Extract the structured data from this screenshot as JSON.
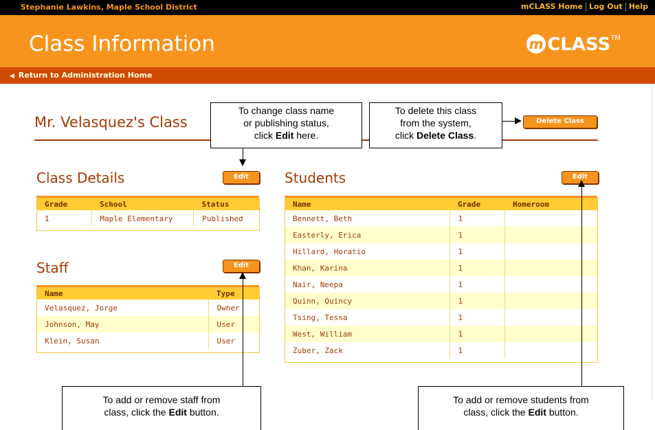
{
  "topbar": {
    "user": "Stephanie Lawkins, Maple School District",
    "links": [
      "mCLASS Home",
      "Log Out",
      "Help"
    ]
  },
  "header": {
    "title": "Class Information",
    "logo_text": "CLASS",
    "logo_m": "m",
    "logo_tm": "TM"
  },
  "subbar": {
    "return_link": "Return to Administration Home"
  },
  "page": {
    "class_title": "Mr. Velasquez's Class",
    "delete_button": "Delete Class"
  },
  "class_details": {
    "title": "Class Details",
    "edit": "Edit",
    "headers": [
      "Grade",
      "School",
      "Status"
    ],
    "row": [
      "1",
      "Maple Elementary",
      "Published"
    ]
  },
  "staff": {
    "title": "Staff",
    "edit": "Edit",
    "headers": [
      "Name",
      "Type"
    ],
    "rows": [
      [
        "Velasquez, Jorge",
        "Owner"
      ],
      [
        "Johnson, May",
        "User"
      ],
      [
        "Klein, Susan",
        "User"
      ]
    ]
  },
  "students": {
    "title": "Students",
    "edit": "Edit",
    "headers": [
      "Name",
      "Grade",
      "Homeroom"
    ],
    "rows": [
      [
        "Bennett, Beth",
        "1",
        ""
      ],
      [
        "Easterly, Erica",
        "1",
        ""
      ],
      [
        "Hillard, Horatio",
        "1",
        ""
      ],
      [
        "Khan, Karina",
        "1",
        ""
      ],
      [
        "Nair, Neepa",
        "1",
        ""
      ],
      [
        "Quinn, Quincy",
        "1",
        ""
      ],
      [
        "Tsing, Tessa",
        "1",
        ""
      ],
      [
        "West, William",
        "1",
        ""
      ],
      [
        "Zuber, Zack",
        "1",
        ""
      ]
    ]
  },
  "callouts": {
    "edit_class": {
      "l1": "To change class name",
      "l2": "or publishing status,",
      "l3a": "click ",
      "l3b": "Edit",
      "l3c": " here."
    },
    "delete_class": {
      "l1": "To delete this class",
      "l2": "from the system,",
      "l3a": "click ",
      "l3b": "Delete Class",
      "l3c": "."
    },
    "staff_edit": {
      "l1": "To add or remove staff from",
      "l2a": "class, click the ",
      "l2b": "Edit",
      "l2c": " button."
    },
    "students_edit": {
      "l1": "To add or remove students from",
      "l2a": "class, click the ",
      "l2b": "Edit",
      "l2c": " button."
    }
  },
  "colors": {
    "orange": "#f7941d",
    "dark_orange": "#d04a02",
    "brown": "#a33a05",
    "table_header": "#ffcc33",
    "row_alt": "#ffffcc"
  }
}
